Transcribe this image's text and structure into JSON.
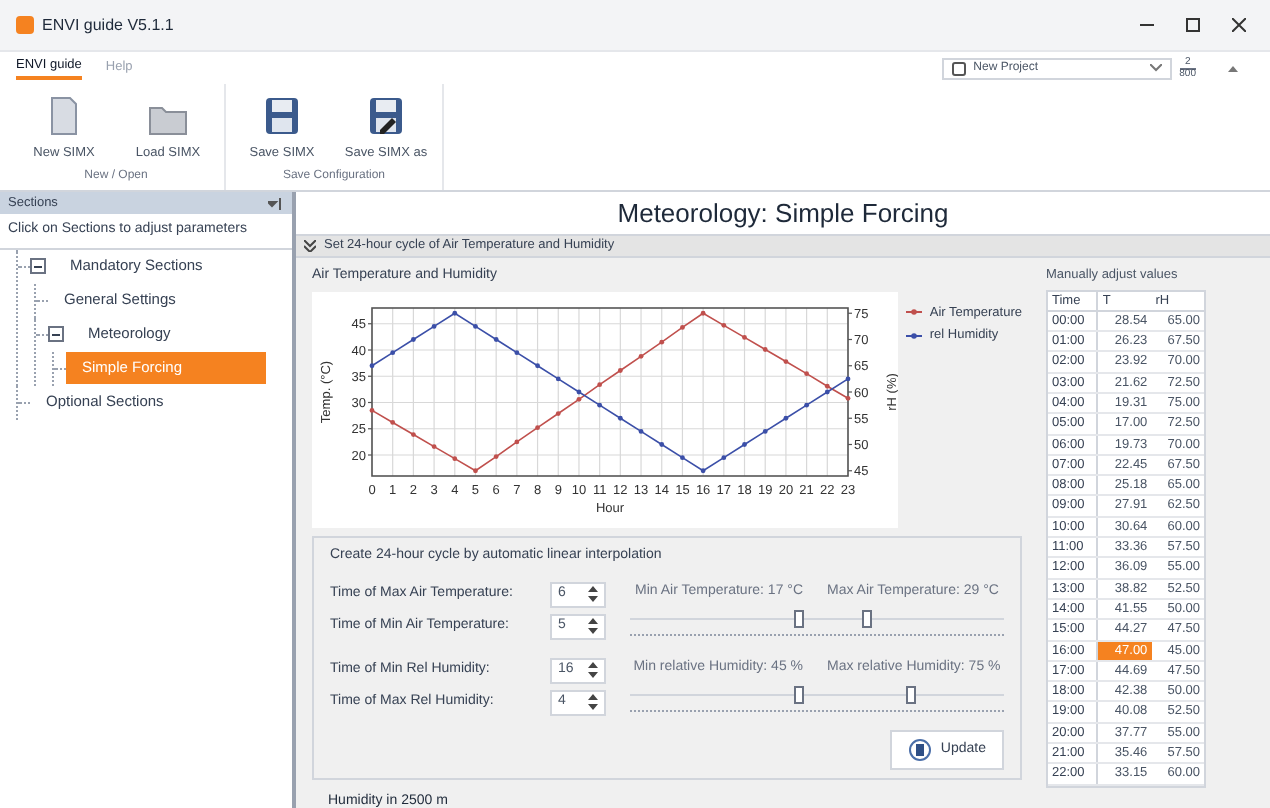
{
  "window": {
    "title": "ENVI guide V5.1.1"
  },
  "menu_tabs": [
    {
      "label": "ENVI guide",
      "selected": true
    },
    {
      "label": "Help",
      "selected": false
    }
  ],
  "project_select": {
    "value": "New Project"
  },
  "zoom_indicator": {
    "numerator": "2",
    "denominator": "800"
  },
  "ribbon": {
    "groups": [
      {
        "label": "New / Open",
        "buttons": [
          {
            "kind": "new",
            "label": "New SIMX"
          },
          {
            "kind": "open",
            "label": "Load SIMX"
          }
        ]
      },
      {
        "label": "Save Configuration",
        "buttons": [
          {
            "kind": "save",
            "label": "Save SIMX"
          },
          {
            "kind": "saveas",
            "label": "Save SIMX as"
          }
        ]
      }
    ]
  },
  "sidebar": {
    "title": "Sections",
    "hint": "Click on Sections to adjust parameters",
    "tree": [
      {
        "label": "Mandatory Sections",
        "expanded": true,
        "selected": false,
        "children": [
          {
            "label": "General Settings",
            "selected": false
          },
          {
            "label": "Meteorology",
            "expanded": true,
            "selected": false,
            "children": [
              {
                "label": "Simple Forcing",
                "selected": true
              }
            ]
          }
        ]
      },
      {
        "label": "Optional Sections",
        "selected": false
      }
    ]
  },
  "page_title": "Meteorology: Simple Forcing",
  "section": {
    "title": "Set 24-hour cycle of Air Temperature and Humidity",
    "expanded": true
  },
  "chart": {
    "chart_data": {
      "type": "line",
      "title": "Air Temperature and Humidity",
      "xlabel": "Hour",
      "ylabel": "Temp. (°C)",
      "y2label": "rH (%)",
      "x": [
        0,
        1,
        2,
        3,
        4,
        5,
        6,
        7,
        8,
        9,
        10,
        11,
        12,
        13,
        14,
        15,
        16,
        17,
        18,
        19,
        20,
        21,
        22,
        23
      ],
      "xlim": [
        0,
        23
      ],
      "ylim": [
        16,
        48
      ],
      "xticks": [
        0,
        1,
        2,
        3,
        4,
        5,
        6,
        7,
        8,
        9,
        10,
        11,
        12,
        13,
        14,
        15,
        16,
        17,
        18,
        19,
        20,
        21,
        22,
        23
      ],
      "yticks": [
        20,
        25,
        30,
        35,
        40,
        45
      ],
      "y2lim": [
        44,
        76
      ],
      "y2ticks": [
        45,
        50,
        55,
        60,
        65,
        70,
        75
      ],
      "grid": true,
      "legend": "right",
      "series": [
        {
          "name": "Air Temperature",
          "color": "#c0504d",
          "values": [
            28.5,
            26.2,
            23.9,
            21.6,
            19.3,
            17.0,
            19.7,
            22.5,
            25.2,
            27.9,
            30.6,
            33.4,
            36.1,
            38.8,
            41.5,
            44.3,
            47.0,
            44.7,
            42.4,
            40.1,
            37.8,
            35.5,
            33.1,
            30.8
          ]
        },
        {
          "name": "rel Humidity",
          "color": "#3b4fa8",
          "axis": "y2",
          "values": [
            65,
            67.5,
            70,
            72.5,
            75,
            72.5,
            70,
            67.5,
            65,
            62.5,
            60,
            57.5,
            55,
            52.5,
            50,
            47.5,
            45,
            47.5,
            50,
            52.5,
            55,
            57.5,
            60,
            62.5
          ]
        }
      ]
    }
  },
  "interpolation": {
    "title": "Create 24-hour cycle by automatic linear interpolation",
    "temperature": {
      "fields": [
        {
          "label": "Time of Max Air Temperature:",
          "value": "6"
        },
        {
          "label": "Time of Min Air Temperature:",
          "value": "5"
        }
      ],
      "min_label": "Min Air Temperature: 17 °C",
      "max_label": "Max Air Temperature: 29 °C",
      "thumbs": [
        {
          "level": 0.45
        },
        {
          "level": 0.63
        }
      ]
    },
    "humidity": {
      "fields": [
        {
          "label": "Time of Min Rel Humidity:",
          "value": "16"
        },
        {
          "label": "Time of Max Rel Humidity:",
          "value": "4"
        }
      ],
      "min_label": "Min relative Humidity: 45 %",
      "max_label": "Max relative Humidity: 75 %",
      "thumbs": [
        {
          "level": 0.45
        },
        {
          "level": 0.75
        }
      ]
    },
    "update_button": "Update"
  },
  "manual_table": {
    "title": "Manually adjust values",
    "columns": [
      "Time",
      "T",
      "rH"
    ],
    "rows": [
      {
        "cells": [
          "00:00",
          "28.54",
          "65.00"
        ],
        "selected": false
      },
      {
        "cells": [
          "01:00",
          "26.23",
          "67.50"
        ],
        "selected": false
      },
      {
        "cells": [
          "02:00",
          "23.92",
          "70.00"
        ],
        "selected": false
      },
      {
        "cells": [
          "03:00",
          "21.62",
          "72.50"
        ],
        "selected": false
      },
      {
        "cells": [
          "04:00",
          "19.31",
          "75.00"
        ],
        "selected": false
      },
      {
        "cells": [
          "05:00",
          "17.00",
          "72.50"
        ],
        "selected": false
      },
      {
        "cells": [
          "06:00",
          "19.73",
          "70.00"
        ],
        "selected": false
      },
      {
        "cells": [
          "07:00",
          "22.45",
          "67.50"
        ],
        "selected": false
      },
      {
        "cells": [
          "08:00",
          "25.18",
          "65.00"
        ],
        "selected": false
      },
      {
        "cells": [
          "09:00",
          "27.91",
          "62.50"
        ],
        "selected": false
      },
      {
        "cells": [
          "10:00",
          "30.64",
          "60.00"
        ],
        "selected": false
      },
      {
        "cells": [
          "11:00",
          "33.36",
          "57.50"
        ],
        "selected": false
      },
      {
        "cells": [
          "12:00",
          "36.09",
          "55.00"
        ],
        "selected": false
      },
      {
        "cells": [
          "13:00",
          "38.82",
          "52.50"
        ],
        "selected": false
      },
      {
        "cells": [
          "14:00",
          "41.55",
          "50.00"
        ],
        "selected": false
      },
      {
        "cells": [
          "15:00",
          "44.27",
          "47.50"
        ],
        "selected": false
      },
      {
        "cells": [
          "16:00",
          "47.00",
          "45.00"
        ],
        "selected": true
      },
      {
        "cells": [
          "17:00",
          "44.69",
          "47.50"
        ],
        "selected": false
      },
      {
        "cells": [
          "18:00",
          "42.38",
          "50.00"
        ],
        "selected": false
      },
      {
        "cells": [
          "19:00",
          "40.08",
          "52.50"
        ],
        "selected": false
      },
      {
        "cells": [
          "20:00",
          "37.77",
          "55.00"
        ],
        "selected": false
      },
      {
        "cells": [
          "21:00",
          "35.46",
          "57.50"
        ],
        "selected": false
      },
      {
        "cells": [
          "22:00",
          "33.15",
          "60.00"
        ],
        "selected": false
      }
    ]
  },
  "humidity_2500": {
    "title": "Humidity in 2500 m"
  }
}
